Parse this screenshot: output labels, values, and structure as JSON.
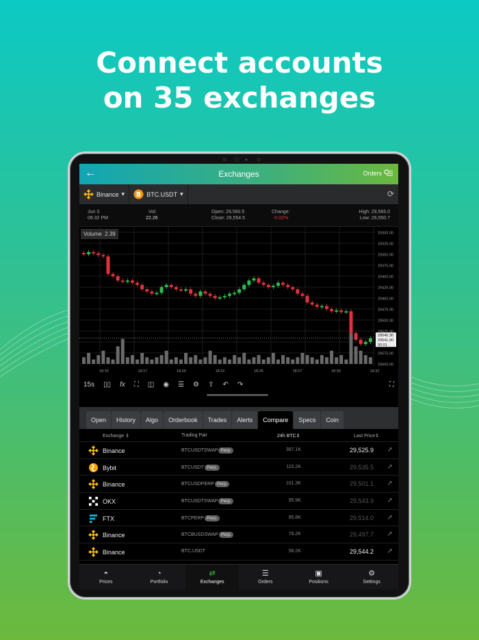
{
  "headline": {
    "line1": "Connect accounts",
    "line2": "on 35 exchanges"
  },
  "topbar": {
    "back_icon": "arrow-left-icon",
    "title": "Exchanges",
    "orders_label": "Orders"
  },
  "selectors": {
    "exchange": "Binance",
    "pair": "BTC.USDT"
  },
  "stats": {
    "date": "Jun 3",
    "time": "06:32 PM",
    "vol_label": "Vol:",
    "vol_value": "22.26",
    "open": "Open: 29,560.5",
    "close": "Close: 29,554.5",
    "change_label": "Change:",
    "change_value": "-0.02%",
    "high": "High: 29,565.0",
    "low": "Low: 29,550.7"
  },
  "chart_data": {
    "type": "candlestick",
    "indicator_label": "Volume",
    "indicator_value": "2.39",
    "y_ticks": [
      "29300.00",
      "29325.00",
      "29350.00",
      "29375.00",
      "29400.00",
      "29425.00",
      "29450.00",
      "29475.00",
      "29500.00",
      "29525.00",
      "29550.00",
      "29575.00",
      "29600.00"
    ],
    "x_ticks": [
      "18:15",
      "18:17",
      "18:20",
      "18:22",
      "18:25",
      "18:27",
      "18:30",
      "18:32"
    ],
    "price_tag": "29540.30",
    "price_tag2": "29541.90",
    "price_tag3": "00:01",
    "closes": [
      29350,
      29345,
      29348,
      29352,
      29355,
      29395,
      29400,
      29410,
      29412,
      29410,
      29415,
      29420,
      29430,
      29435,
      29440,
      29438,
      29425,
      29420,
      29425,
      29430,
      29432,
      29430,
      29440,
      29445,
      29435,
      29440,
      29445,
      29450,
      29448,
      29445,
      29440,
      29438,
      29430,
      29420,
      29410,
      29405,
      29415,
      29420,
      29425,
      29422,
      29415,
      29420,
      29425,
      29430,
      29440,
      29445,
      29460,
      29465,
      29470,
      29468,
      29475,
      29480,
      29478,
      29482,
      29480,
      29530,
      29545,
      29555,
      29550,
      29542
    ]
  },
  "toolbar": {
    "interval": "15s"
  },
  "tabs": [
    "Open",
    "History",
    "Algo",
    "Orderbook",
    "Trades",
    "Alerts",
    "Compare",
    "Specs",
    "Coin"
  ],
  "active_tab": "Compare",
  "table": {
    "headers": {
      "exchange": "Exchange ⇕",
      "pair": "Trading Pair",
      "vol": "24h BTC⇕",
      "price": "Last Price⇕"
    },
    "rows": [
      {
        "exchange": "Binance",
        "icon": "binance",
        "pair": "BTCUSDTSWAP",
        "perp": "Perp.",
        "vol": "387.1K",
        "price": "29,525.9",
        "bright": true
      },
      {
        "exchange": "Bybit",
        "icon": "bybit",
        "pair": "BTCUSDT",
        "perp": "Perp.",
        "vol": "115.2K",
        "price": "29,535.5",
        "bright": false
      },
      {
        "exchange": "Binance",
        "icon": "binance",
        "pair": "BTCUSDPERP",
        "perp": "Perp.",
        "vol": "101.3K",
        "price": "29,501.1",
        "bright": false
      },
      {
        "exchange": "OKX",
        "icon": "okx",
        "pair": "BTCUSDTSWAP",
        "perp": "Perp.",
        "vol": "95.9K",
        "price": "29,543.9",
        "bright": false
      },
      {
        "exchange": "FTX",
        "icon": "ftx",
        "pair": "BTCPERP",
        "perp": "Perp.",
        "vol": "85.8K",
        "price": "29,514.0",
        "bright": false
      },
      {
        "exchange": "Binance",
        "icon": "binance",
        "pair": "BTCBUSDSWAP",
        "perp": "Perp.",
        "vol": "76.2K",
        "price": "29,497.7",
        "bright": false
      },
      {
        "exchange": "Binance",
        "icon": "binance",
        "pair": "BTC.USDT",
        "perp": "",
        "vol": "58.2K",
        "price": "29,544.2",
        "bright": true
      }
    ]
  },
  "nav": [
    {
      "label": "Prices",
      "icon": "prices-icon"
    },
    {
      "label": "Portfolio",
      "icon": "portfolio-icon"
    },
    {
      "label": "Exchanges",
      "icon": "exchanges-icon"
    },
    {
      "label": "Orders",
      "icon": "orders-icon"
    },
    {
      "label": "Positions",
      "icon": "positions-icon"
    },
    {
      "label": "Settings",
      "icon": "settings-icon"
    }
  ],
  "colors": {
    "up": "#2ebd4e",
    "down": "#e0323c",
    "accent": "#15b3b8"
  }
}
